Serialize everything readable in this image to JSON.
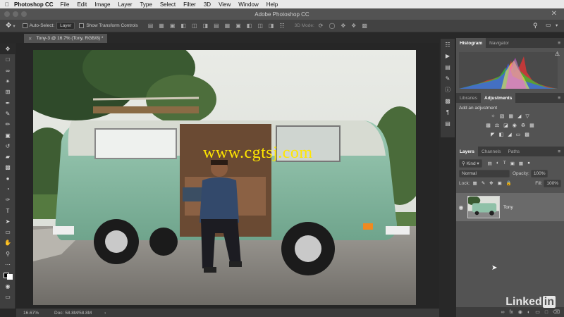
{
  "menubar": {
    "app_name": "Photoshop CC",
    "items": [
      "File",
      "Edit",
      "Image",
      "Layer",
      "Type",
      "Select",
      "Filter",
      "3D",
      "View",
      "Window",
      "Help"
    ]
  },
  "window": {
    "title": "Adobe Photoshop CC"
  },
  "options": {
    "auto_select_label": "Auto-Select:",
    "auto_select_value": "Layer",
    "show_transform_label": "Show Transform Controls",
    "mode_3d_label": "3D Mode:"
  },
  "document": {
    "tab_label": "Tony-3 @ 16.7% (Tony, RGB/8) *",
    "zoom": "16.67%",
    "doc_size": "Doc: 58.8M/58.8M"
  },
  "watermark": "www.cgtsj.com",
  "panels": {
    "top_tabs": [
      "Histogram",
      "Navigator"
    ],
    "mid_tabs": [
      "Libraries",
      "Adjustments"
    ],
    "add_adjustment": "Add an adjustment",
    "layer_tabs": [
      "Layers",
      "Channels",
      "Paths"
    ],
    "kind_label": "Kind",
    "blend_mode": "Normal",
    "opacity_label": "Opacity:",
    "opacity_value": "100%",
    "lock_label": "Lock:",
    "fill_label": "Fill:",
    "fill_value": "100%",
    "layer_name": "Tony"
  },
  "branding": {
    "linked": "Linked",
    "in": "in"
  },
  "colors": {
    "accent": "#ffe600",
    "panel": "#535353",
    "van_green": "#8fc1a8"
  }
}
